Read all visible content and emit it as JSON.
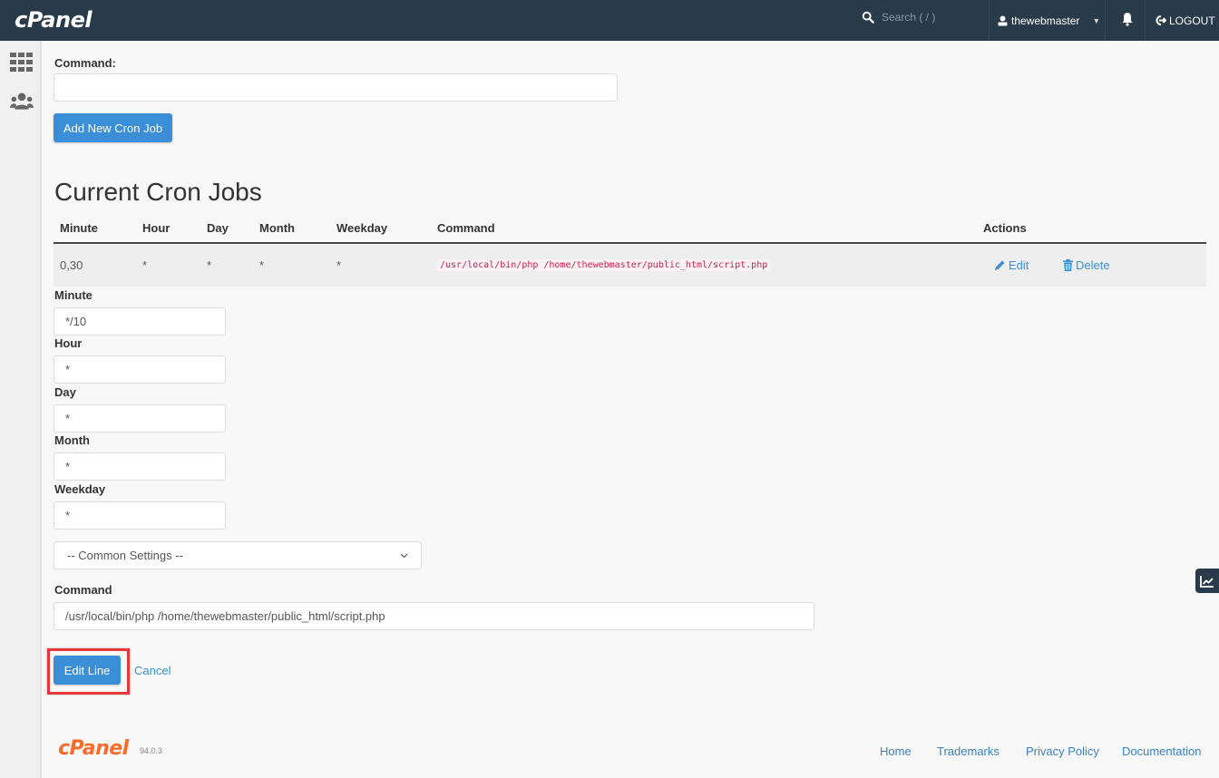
{
  "header": {
    "logo": "cPanel",
    "search_placeholder": "Search ( / )",
    "username": "thewebmaster",
    "logout_label": "LOGOUT"
  },
  "sidebar": {
    "items": [
      {
        "icon": "grid-icon",
        "label": "Tools"
      },
      {
        "icon": "users-icon",
        "label": "Users"
      }
    ]
  },
  "add_form": {
    "command_label": "Command:",
    "command_value": "",
    "add_button": "Add New Cron Job"
  },
  "current_jobs": {
    "title": "Current Cron Jobs",
    "columns": [
      "Minute",
      "Hour",
      "Day",
      "Month",
      "Weekday",
      "Command",
      "Actions"
    ],
    "rows": [
      {
        "minute": "0,30",
        "hour": "*",
        "day": "*",
        "month": "*",
        "weekday": "*",
        "command": "/usr/local/bin/php /home/thewebmaster/public_html/script.php",
        "edit_label": "Edit",
        "delete_label": "Delete"
      }
    ]
  },
  "edit_form": {
    "minute_label": "Minute",
    "minute_value": "*/10",
    "hour_label": "Hour",
    "hour_value": "*",
    "day_label": "Day",
    "day_value": "*",
    "month_label": "Month",
    "month_value": "*",
    "weekday_label": "Weekday",
    "weekday_value": "*",
    "common_settings": "-- Common Settings --",
    "command_label": "Command",
    "command_value": "/usr/local/bin/php /home/thewebmaster/public_html/script.php",
    "submit_label": "Edit Line",
    "cancel_label": "Cancel"
  },
  "footer": {
    "logo": "cPanel",
    "version": "94.0.3",
    "links": [
      "Home",
      "Trademarks",
      "Privacy Policy",
      "Documentation"
    ]
  },
  "colors": {
    "topbar": "#293a4a",
    "primary": "#3b8fd9",
    "highlight": "#e5383b",
    "brand_orange": "#ff6c2c",
    "code": "#c7254e"
  }
}
